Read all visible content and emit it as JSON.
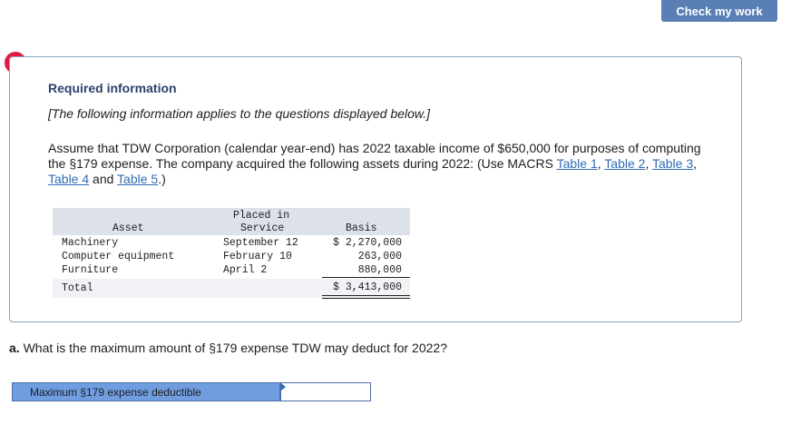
{
  "header": {
    "check_button": "Check my work"
  },
  "alert": {
    "icon": "!"
  },
  "info": {
    "title": "Required information",
    "subtitle": "[The following information applies to the questions displayed below.]",
    "paragraph_text": "Assume that TDW Corporation (calendar year-end) has 2022 taxable income of $650,000 for purposes of computing the §179 expense. The company acquired the following assets during 2022: (Use MACRS ",
    "links": [
      "Table 1",
      "Table 2",
      "Table 3",
      "Table 4",
      "Table 5"
    ],
    "link_sep1": ", ",
    "link_sep2": " and ",
    "paragraph_end": ".)"
  },
  "assets_table": {
    "headers": {
      "asset": "Asset",
      "placed_line1": "Placed in",
      "placed_line2": "Service",
      "basis": "Basis"
    },
    "rows": [
      {
        "asset": "Machinery",
        "placed": "September 12",
        "basis": "$ 2,270,000"
      },
      {
        "asset": "Computer equipment",
        "placed": "February 10",
        "basis": "263,000"
      },
      {
        "asset": "Furniture",
        "placed": "April 2",
        "basis": "880,000"
      }
    ],
    "total": {
      "label": "Total",
      "basis": "$ 3,413,000"
    }
  },
  "question": {
    "prefix": "a.",
    "text": " What is the maximum amount of §179 expense TDW may deduct for 2022?"
  },
  "answer": {
    "label": "Maximum §179 expense deductible",
    "value": ""
  },
  "colors": {
    "button": "#5a7fb5",
    "alert": "#e1194b",
    "link": "#2f6db5",
    "answer_label_bg": "#6f9de0"
  }
}
